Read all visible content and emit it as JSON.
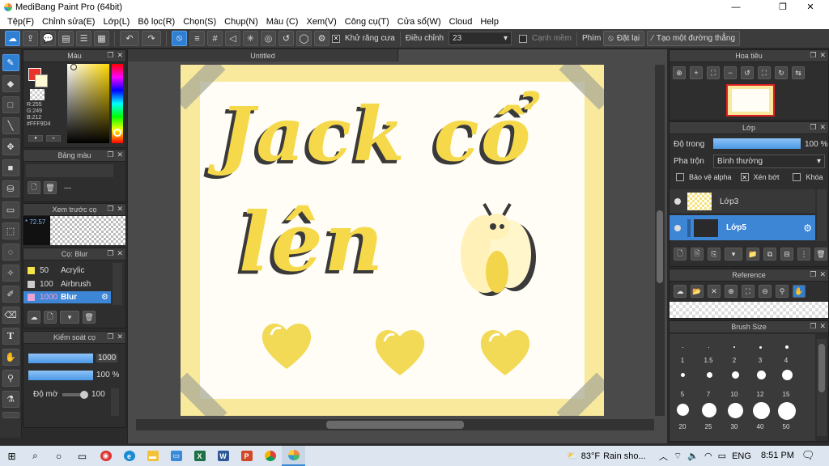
{
  "window": {
    "title": "MediBang Paint Pro (64bit)"
  },
  "menu": [
    "Tệp(F)",
    "Chỉnh sửa(E)",
    "Lớp(L)",
    "Bộ lọc(R)",
    "Chọn(S)",
    "Chụp(N)",
    "Màu (C)",
    "Xem(V)",
    "Công cụ(T)",
    "Cửa sổ(W)",
    "Cloud",
    "Help"
  ],
  "toolbar": {
    "antialias_label": "Khử răng cưa",
    "adjust_label": "Điều chỉnh",
    "adjust_value": "23",
    "edge_label": "Cạnh mềm",
    "key_label": "Phím",
    "reset_label": "Đặt lại",
    "straight_line_label": "Tạo một đường thẳng"
  },
  "color_panel": {
    "title": "Màu",
    "r": "R:255",
    "g": "G:249",
    "b": "B:212",
    "hex": "#FFF9D4",
    "primary_color": "#e8322a",
    "secondary_color": "#fff9d4"
  },
  "palette_panel": {
    "title": "Bảng màu",
    "entry": "---"
  },
  "brush_preview_panel": {
    "title": "Xem trước cọ",
    "size": "* 72.57"
  },
  "brush_panel": {
    "title": "Cọ: Blur",
    "items": [
      {
        "size": "50",
        "name": "Acrylic",
        "color": "#f2e64a"
      },
      {
        "size": "100",
        "name": "Airbrush",
        "color": "#cccccc"
      },
      {
        "size": "1000",
        "name": "Blur",
        "color": "#e9a3d8"
      }
    ]
  },
  "brush_control_panel": {
    "title": "Kiểm soát cọ",
    "size_value": "1000",
    "opacity_value": "100 %",
    "smoothing_label": "Độ mờ",
    "smoothing_value": "100"
  },
  "canvas": {
    "tab_title": "Untitled",
    "art_line1": "Jack cổ",
    "art_line2": "lên"
  },
  "navigator_panel": {
    "title": "Hoa tiêu"
  },
  "layer_panel": {
    "title": "Lớp",
    "opacity_label": "Độ trong",
    "opacity_value": "100 %",
    "blend_label": "Pha trộn",
    "blend_value": "Bình thường",
    "protect_alpha": "Bảo vệ alpha",
    "clipping": "Xén bớt",
    "lock": "Khóa",
    "layers": [
      {
        "name": "Lớp3",
        "selected": false
      },
      {
        "name": "Lớp5",
        "selected": true
      }
    ]
  },
  "reference_panel": {
    "title": "Reference"
  },
  "brush_size_panel": {
    "title": "Brush Size",
    "sizes": [
      "1",
      "1.5",
      "2",
      "3",
      "4",
      "5",
      "7",
      "10",
      "12",
      "15",
      "20",
      "25",
      "30",
      "40",
      "50"
    ]
  },
  "taskbar": {
    "weather_temp": "83°F",
    "weather_text": "Rain sho...",
    "lang": "ENG",
    "time": "8:51 PM"
  }
}
